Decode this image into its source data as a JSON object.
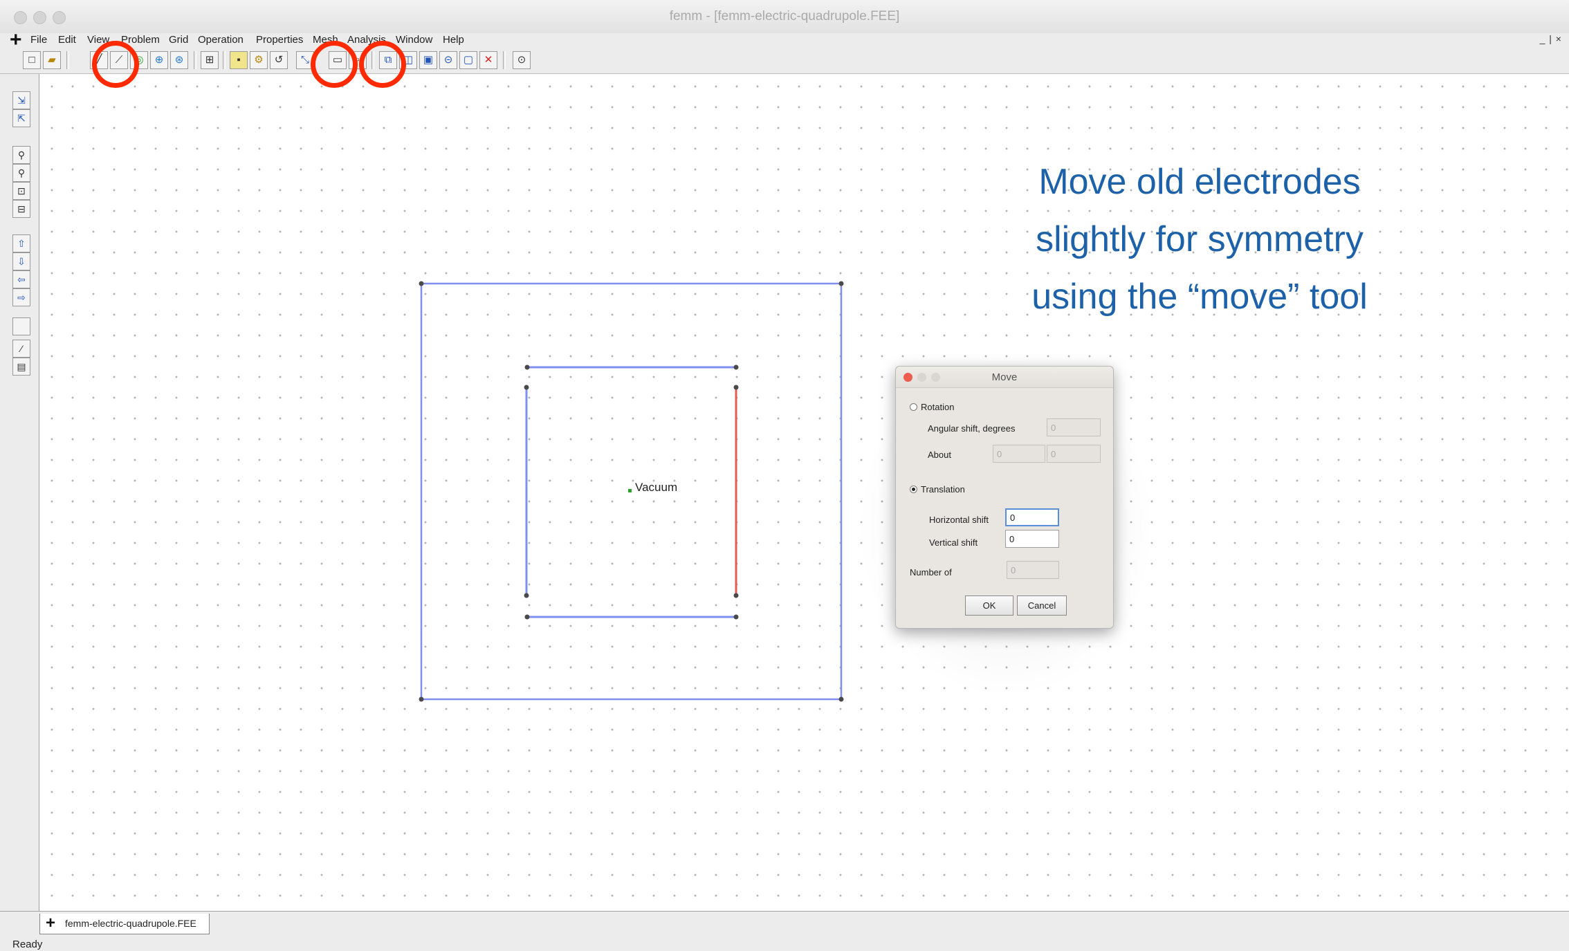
{
  "window": {
    "title": "femm - [femm-electric-quadrupole.FEE]",
    "mdi_controls": "_ | ×"
  },
  "menubar": {
    "items": [
      "File",
      "Edit",
      "View",
      "Problem",
      "Grid",
      "Operation",
      "Properties",
      "Mesh",
      "Analysis",
      "Window",
      "Help"
    ]
  },
  "toolbar": {
    "buttons": [
      "new-file-icon",
      "open-file-icon",
      "operate-on-nodes-icon",
      "operate-on-segments-icon",
      "operate-on-arcs-icon",
      "operate-on-block-labels-icon",
      "operate-on-groups-icon",
      "show-grid-icon",
      "snap-grid-icon",
      "set-grid-icon",
      "undo-icon",
      "copy-icon",
      "move-icon",
      "scale-icon",
      "mirror-icon",
      "create-radius-icon",
      "create-open-boundary-icon",
      "offset-icon",
      "delete-icon",
      "run-mesher-icon"
    ]
  },
  "sidebar": {
    "buttons": [
      "zoom-previous-icon",
      "zoom-natural-icon",
      "zoom-in-icon",
      "zoom-out-icon",
      "zoom-window-icon",
      "zoom-fit-icon",
      "pan-up-icon",
      "pan-down-icon",
      "pan-left-icon",
      "pan-right-icon",
      "blank-icon",
      "analyze-icon",
      "view-results-icon"
    ]
  },
  "canvas": {
    "region_label": "Vacuum",
    "colors": {
      "boundary": "#7f8ff0",
      "electrode": "#e85a5a",
      "node": "#4a4a4a",
      "grid_dot": "#b3b3b3"
    }
  },
  "annotation": {
    "lines": [
      "Move old electrodes",
      "slightly for symmetry",
      "using the “move” tool"
    ],
    "color": "#1d62a8"
  },
  "highlights": {
    "color": "#ff2a00",
    "targets": [
      "operate-on-segments-button",
      "copy-button",
      "move-button"
    ]
  },
  "dialog": {
    "title": "Move",
    "rotation_label": "Rotation",
    "angular_shift_label": "Angular shift, degrees",
    "angular_shift_value": "0",
    "about_label": "About",
    "about_x_value": "0",
    "about_y_value": "0",
    "translation_label": "Translation",
    "horizontal_shift_label": "Horizontal shift",
    "horizontal_shift_value": "0",
    "vertical_shift_label": "Vertical shift",
    "vertical_shift_value": "0",
    "number_of_label": "Number of",
    "number_of_value": "0",
    "ok_label": "OK",
    "cancel_label": "Cancel",
    "selected_mode": "Translation"
  },
  "document_tab": {
    "label": "femm-electric-quadrupole.FEE"
  },
  "status": {
    "text": "Ready"
  }
}
